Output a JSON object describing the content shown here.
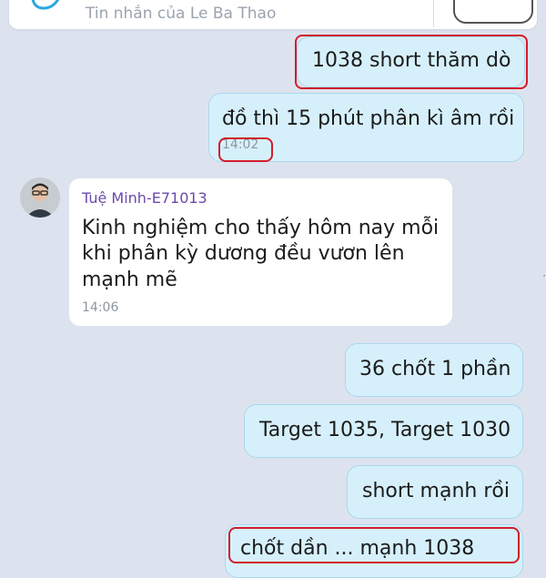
{
  "header": {
    "input_placeholder": "Tin nhắn của Le Ba Thao"
  },
  "messages": [
    {
      "id": "m1",
      "direction": "out",
      "text": "1038 short thăm dò"
    },
    {
      "id": "m2",
      "direction": "out",
      "text": "đồ thì 15 phút phân kì âm rồi",
      "time": "14:02"
    },
    {
      "id": "m3",
      "direction": "in",
      "sender": "Tuệ Minh-E71013",
      "text_lines": [
        "Kinh nghiệm cho thấy hôm nay mỗi",
        "khi phân kỳ dương đều vươn lên",
        "mạnh mẽ"
      ],
      "time": "14:06"
    },
    {
      "id": "m4",
      "direction": "out",
      "text": "36 chốt 1 phần"
    },
    {
      "id": "m5",
      "direction": "out",
      "text": "Target 1035, Target 1030"
    },
    {
      "id": "m6",
      "direction": "out",
      "text": "short mạnh rồi"
    },
    {
      "id": "m7",
      "direction": "out",
      "text": "chốt dần ... mạnh 1038"
    }
  ],
  "colors": {
    "background": "#dde3ee",
    "outgoing_bubble": "#d6f0fb",
    "incoming_bubble": "#ffffff",
    "sender_name": "#6a4aa8",
    "highlight": "#d21c2c"
  },
  "icons": {
    "chat": "chat-bubble-icon",
    "avatar": "user-avatar"
  }
}
